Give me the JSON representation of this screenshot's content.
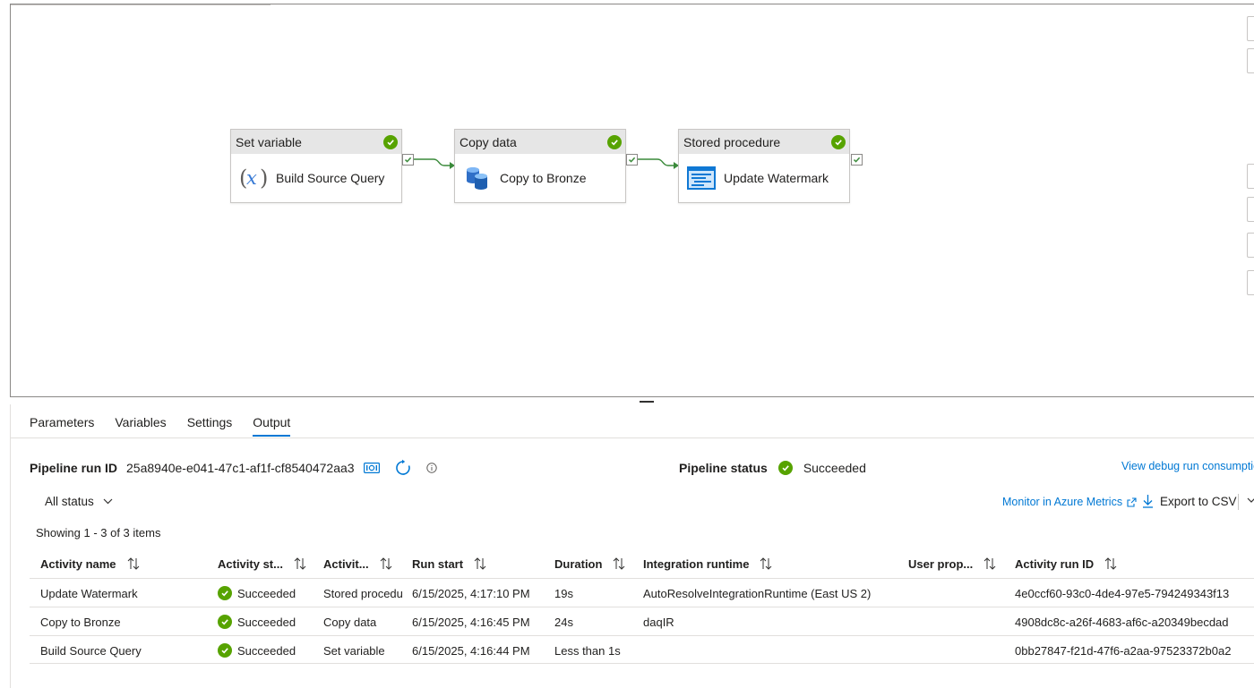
{
  "canvas": {
    "activities": [
      {
        "type": "Set variable",
        "name": "Build Source Query",
        "icon": "variable-icon"
      },
      {
        "type": "Copy data",
        "name": "Copy to Bronze",
        "icon": "database-copy-icon"
      },
      {
        "type": "Stored procedure",
        "name": "Update Watermark",
        "icon": "stored-procedure-icon"
      }
    ]
  },
  "tabs": [
    "Parameters",
    "Variables",
    "Settings",
    "Output"
  ],
  "active_tab": "Output",
  "run": {
    "id_label": "Pipeline run ID",
    "id": "25a8940e-e041-47c1-af1f-cf8540472aa3",
    "status_label": "Pipeline status",
    "status": "Succeeded",
    "debug_link": "View debug run consumption"
  },
  "toolbar": {
    "filter": "All status",
    "metrics_link": "Monitor in Azure Metrics",
    "export": "Export to CSV"
  },
  "showing": "Showing 1 - 3 of 3 items",
  "table": {
    "headers": [
      "Activity name",
      "Activity st...",
      "Activit...",
      "Run start",
      "Duration",
      "Integration runtime",
      "User prop...",
      "Activity run ID"
    ],
    "rows": [
      {
        "name": "Update Watermark",
        "status": "Succeeded",
        "type": "Stored procedu",
        "run_start": "6/15/2025, 4:17:10 PM",
        "duration": "19s",
        "runtime": "AutoResolveIntegrationRuntime (East US 2)",
        "user_props": "",
        "run_id": "4e0ccf60-93c0-4de4-97e5-794249343f13"
      },
      {
        "name": "Copy to Bronze",
        "status": "Succeeded",
        "type": "Copy data",
        "run_start": "6/15/2025, 4:16:45 PM",
        "duration": "24s",
        "runtime": "daqIR",
        "user_props": "",
        "run_id": "4908dc8c-a26f-4683-af6c-a20349becdad"
      },
      {
        "name": "Build Source Query",
        "status": "Succeeded",
        "type": "Set variable",
        "run_start": "6/15/2025, 4:16:44 PM",
        "duration": "Less than 1s",
        "runtime": "",
        "user_props": "",
        "run_id": "0bb27847-f21d-47f6-a2aa-97523372b0a2"
      }
    ]
  },
  "colors": {
    "success": "#57a300",
    "link": "#0078d4",
    "accent": "#0078d4"
  }
}
